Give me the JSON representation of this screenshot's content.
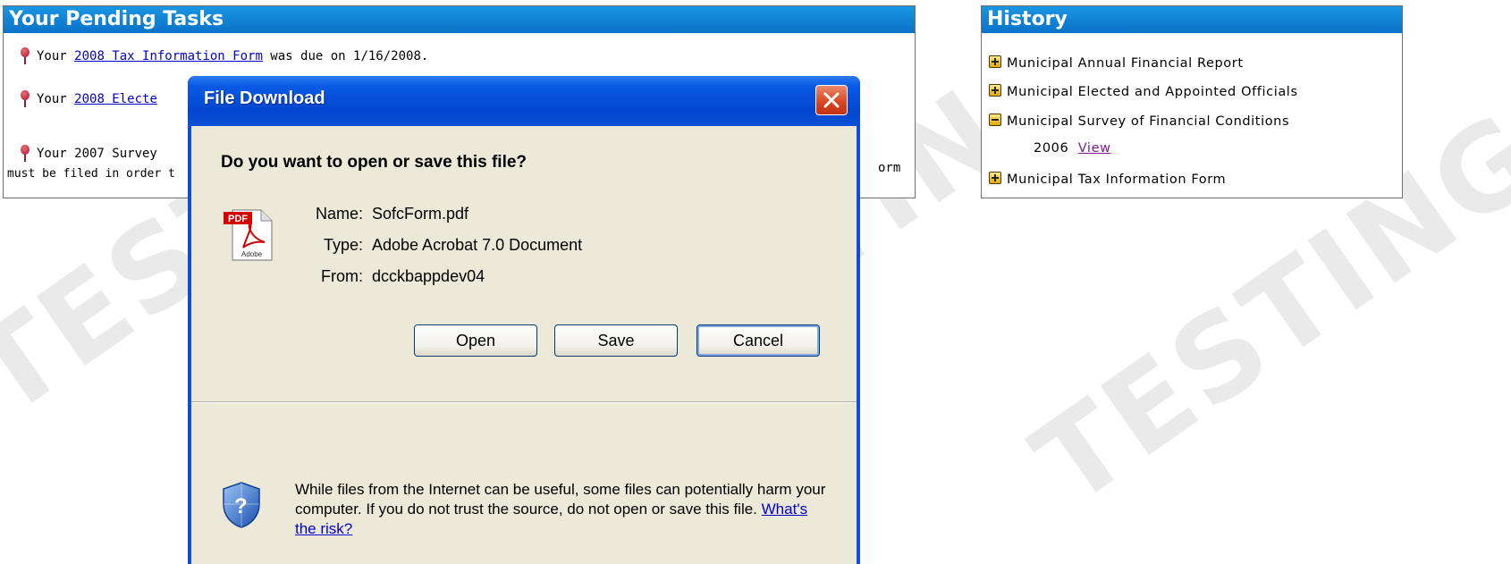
{
  "watermark": {
    "text": "TESTING"
  },
  "tasks_panel": {
    "title": "Your Pending Tasks",
    "items": [
      {
        "prefix": "Your ",
        "link": "2008 Tax Information Form",
        "suffix": " was due on 1/16/2008."
      },
      {
        "prefix": "Your ",
        "link": "2008 Electe"
      },
      {
        "prefix": "Your 2007 Survey",
        "right_text": "orm",
        "line2": "must be filed in order t"
      }
    ]
  },
  "history_panel": {
    "title": "History",
    "items": [
      {
        "label": "Municipal Annual Financial Report",
        "state": "expand"
      },
      {
        "label": "Municipal Elected and Appointed Officials",
        "state": "expand"
      },
      {
        "label": "Municipal Survey of Financial Conditions",
        "state": "collapse"
      },
      {
        "label": "Municipal Tax Information Form",
        "state": "expand"
      }
    ],
    "sub_item": {
      "year": "2006",
      "link": "View"
    }
  },
  "dialog": {
    "title": "File Download",
    "question": "Do you want to open or save this file?",
    "name_label": "Name:",
    "name_value": "SofcForm.pdf",
    "type_label": "Type:",
    "type_value": "Adobe Acrobat 7.0 Document",
    "from_label": "From:",
    "from_value": "dcckbappdev04",
    "buttons": {
      "open": "Open",
      "save": "Save",
      "cancel": "Cancel"
    },
    "warning_text": "While files from the Internet can be useful, some files can potentially harm your computer. If you do not trust the source, do not open or save this file.",
    "risk_link": "What's the risk?",
    "icon_text": {
      "pdf": "PDF",
      "adobe": "Adobe"
    }
  },
  "colors": {
    "panel_header": "#0a72c8",
    "dialog_title": "#0347cf",
    "dialog_body": "#ece9d8",
    "link": "#0000cc",
    "visited_link": "#7a1f8a"
  }
}
